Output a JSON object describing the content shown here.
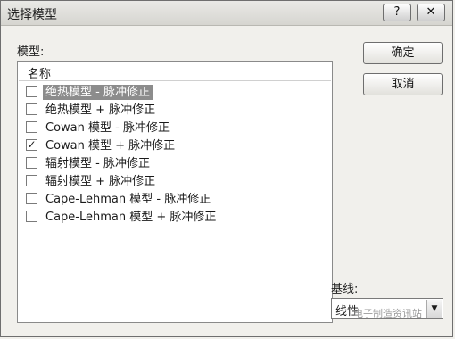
{
  "window": {
    "title": "选择模型",
    "help_label": "?",
    "close_label": "✕"
  },
  "model_label": "模型:",
  "list": {
    "column_header": "名称",
    "items": [
      {
        "label": "绝热模型 - 脉冲修正",
        "checked": false,
        "selected": true
      },
      {
        "label": "绝热模型 + 脉冲修正",
        "checked": false,
        "selected": false
      },
      {
        "label": "Cowan 模型 - 脉冲修正",
        "checked": false,
        "selected": false
      },
      {
        "label": "Cowan 模型 + 脉冲修正",
        "checked": true,
        "selected": false
      },
      {
        "label": "辐射模型 - 脉冲修正",
        "checked": false,
        "selected": false
      },
      {
        "label": "辐射模型 + 脉冲修正",
        "checked": false,
        "selected": false
      },
      {
        "label": "Cape-Lehman 模型 - 脉冲修正",
        "checked": false,
        "selected": false
      },
      {
        "label": "Cape-Lehman 模型 + 脉冲修正",
        "checked": false,
        "selected": false
      }
    ]
  },
  "buttons": {
    "ok": "确定",
    "cancel": "取消"
  },
  "baseline": {
    "label": "基线:",
    "selected_value": "线性"
  },
  "watermark": "电子制造资讯站"
}
